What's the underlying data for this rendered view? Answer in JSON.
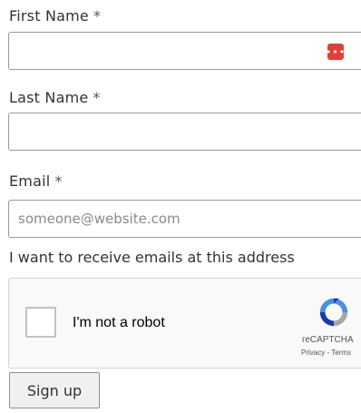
{
  "form": {
    "first_name": {
      "label": "First Name",
      "required_mark": "*",
      "value": "",
      "placeholder": ""
    },
    "last_name": {
      "label": "Last Name",
      "required_mark": "*",
      "value": "",
      "placeholder": ""
    },
    "email": {
      "label": "Email",
      "required_mark": "*",
      "value": "",
      "placeholder": "someone@website.com"
    },
    "consent_text": "I want to receive emails at this address",
    "submit_label": "Sign up"
  },
  "password_manager_icon": {
    "name": "password-manager-icon",
    "glyph": "•••",
    "color": "#e0403a"
  },
  "recaptcha": {
    "checkbox_label": "I'm not a robot",
    "brand": "reCAPTCHA",
    "links": "Privacy - Terms",
    "icon": "recaptcha-logo-icon"
  }
}
